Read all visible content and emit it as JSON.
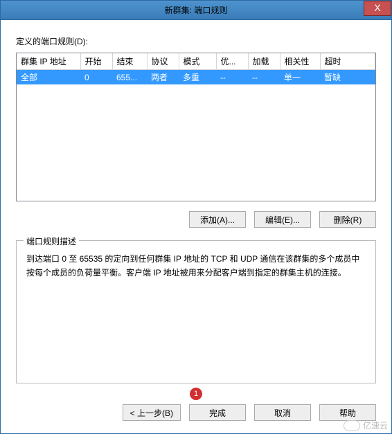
{
  "window": {
    "title": "新群集: 端口规则",
    "close": "X"
  },
  "labels": {
    "defined_rules": "定义的端口规则(D):"
  },
  "table": {
    "headers": {
      "cluster_ip": "群集 IP 地址",
      "start": "开始",
      "end": "结束",
      "protocol": "协议",
      "mode": "模式",
      "priority": "优...",
      "load": "加载",
      "affinity": "相关性",
      "timeout": "超时"
    },
    "rows": [
      {
        "cluster_ip": "全部",
        "start": "0",
        "end": "655...",
        "protocol": "两者",
        "mode": "多重",
        "priority": "--",
        "load": "--",
        "affinity": "单一",
        "timeout": "暂缺"
      }
    ]
  },
  "buttons": {
    "add": "添加(A)...",
    "edit": "编辑(E)...",
    "remove": "删除(R)",
    "back": "< 上一步(B)",
    "finish": "完成",
    "cancel": "取消",
    "help": "帮助"
  },
  "description": {
    "legend": "端口规则描述",
    "text": "到达端口 0 至 65535 的定向到任何群集 IP 地址的 TCP 和 UDP 通信在该群集的多个成员中按每个成员的负荷量平衡。客户端 IP 地址被用来分配客户端到指定的群集主机的连接。"
  },
  "annotation": {
    "num": "1"
  },
  "watermark": {
    "text": "亿速云"
  }
}
